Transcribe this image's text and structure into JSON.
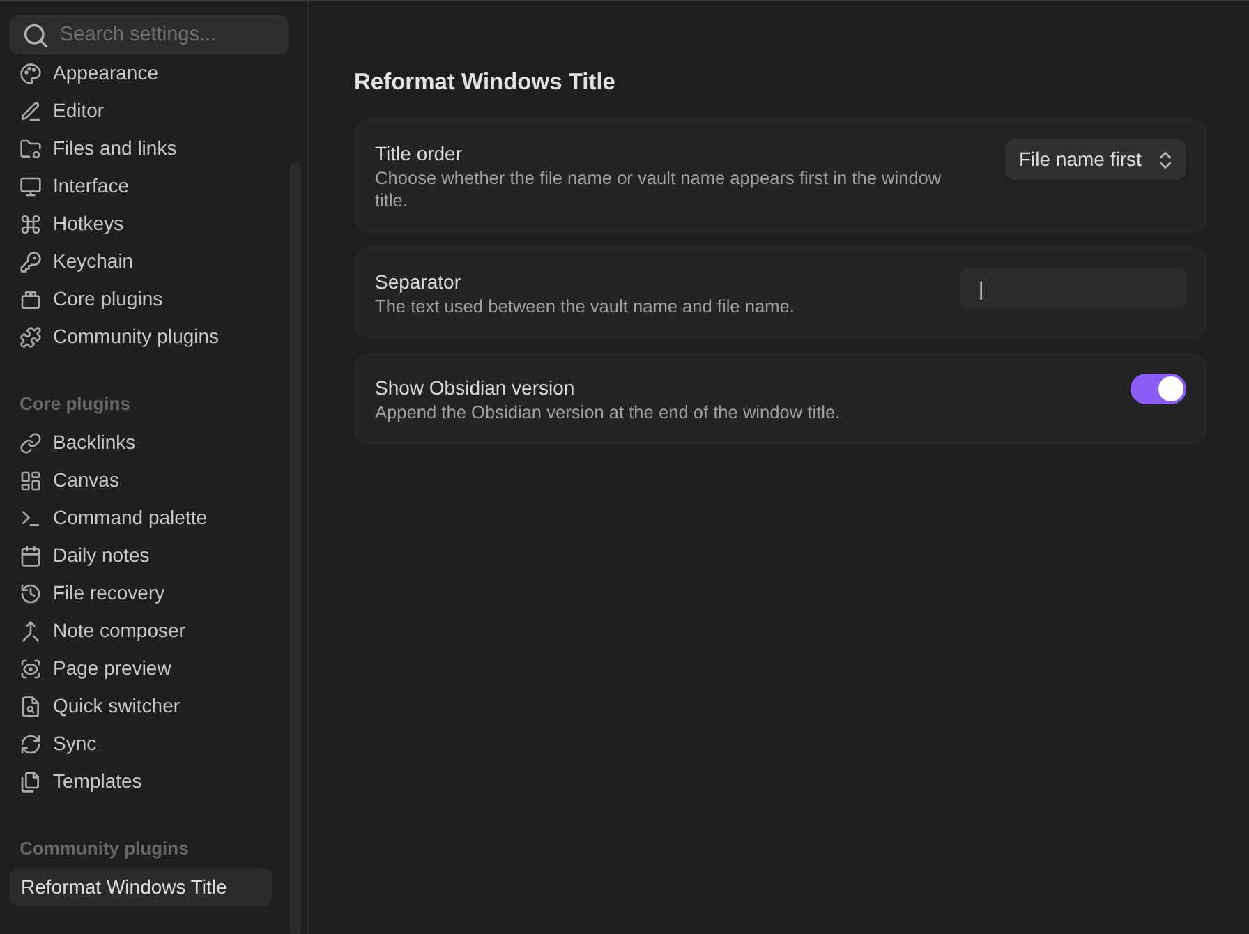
{
  "search": {
    "placeholder": "Search settings..."
  },
  "sidebar": {
    "groups": [
      {
        "items": [
          {
            "label": "Appearance",
            "selected": false
          },
          {
            "label": "Editor",
            "selected": false
          },
          {
            "label": "Files and links",
            "selected": false
          },
          {
            "label": "Interface",
            "selected": false
          },
          {
            "label": "Hotkeys",
            "selected": false
          },
          {
            "label": "Keychain",
            "selected": false
          },
          {
            "label": "Core plugins",
            "selected": false
          },
          {
            "label": "Community plugins",
            "selected": false
          }
        ]
      },
      {
        "heading": "Core plugins",
        "items": [
          {
            "label": "Backlinks",
            "selected": false
          },
          {
            "label": "Canvas",
            "selected": false
          },
          {
            "label": "Command palette",
            "selected": false
          },
          {
            "label": "Daily notes",
            "selected": false
          },
          {
            "label": "File recovery",
            "selected": false
          },
          {
            "label": "Note composer",
            "selected": false
          },
          {
            "label": "Page preview",
            "selected": false
          },
          {
            "label": "Quick switcher",
            "selected": false
          },
          {
            "label": "Sync",
            "selected": false
          },
          {
            "label": "Templates",
            "selected": false
          }
        ]
      },
      {
        "heading": "Community plugins",
        "items": [
          {
            "label": "Reformat Windows Title",
            "selected": true
          }
        ]
      }
    ]
  },
  "page": {
    "title": "Reformat Windows Title",
    "settings": [
      {
        "kind": "dropdown",
        "name": "Title order",
        "description": "Choose whether the file name or vault name appears first in the window title.",
        "value": "File name first"
      },
      {
        "kind": "text",
        "name": "Separator",
        "description": "The text used between the vault name and file name.",
        "value": "|"
      },
      {
        "kind": "toggle",
        "name": "Show Obsidian version",
        "description": "Append the Obsidian version at the end of the window title.",
        "on": true
      }
    ]
  }
}
